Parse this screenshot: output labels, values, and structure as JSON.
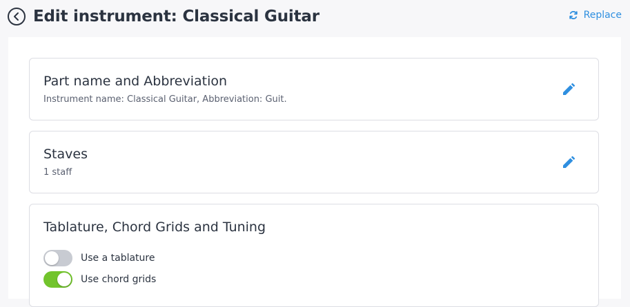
{
  "header": {
    "title": "Edit instrument: Classical Guitar",
    "replace_label": "Replace"
  },
  "cards": {
    "part_name": {
      "title": "Part name and Abbreviation",
      "subtitle": "Instrument name: Classical Guitar, Abbreviation: Guit."
    },
    "staves": {
      "title": "Staves",
      "subtitle": "1 staff"
    },
    "tablature": {
      "title": "Tablature, Chord Grids and Tuning",
      "toggles": [
        {
          "label": "Use a tablature",
          "on": false
        },
        {
          "label": "Use chord grids",
          "on": true
        }
      ]
    }
  },
  "icons": {
    "back": "back-arrow-circle-icon",
    "replace": "refresh-icon",
    "edit": "pencil-icon"
  },
  "colors": {
    "accent": "#2f8fe0",
    "toggle_on": "#72c42c",
    "toggle_off": "#c8cbd2",
    "title_text": "#2b3340"
  }
}
